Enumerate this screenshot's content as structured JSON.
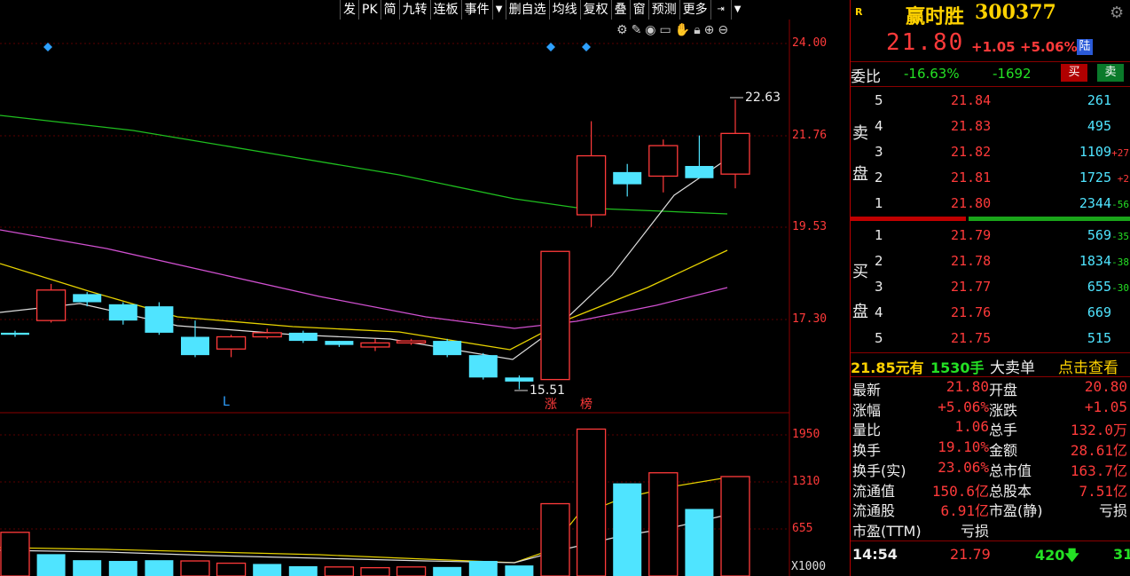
{
  "toolbar": {
    "items": [
      "发",
      "PK",
      "简",
      "九转",
      "连板",
      "事件",
      "删自选",
      "均线",
      "复权",
      "叠",
      "窗",
      "预测",
      "更多"
    ]
  },
  "chart": {
    "price_ticks": [
      "24.00",
      "21.76",
      "19.53",
      "17.30"
    ],
    "volume_ticks": [
      "1950",
      "1310",
      "655",
      "X1000"
    ],
    "high_label": "22.63",
    "low_label": "15.51",
    "tag_zhang": "涨",
    "tag_bang": "榜",
    "tag_l": "L"
  },
  "stock": {
    "badge": "R",
    "name": "赢时胜",
    "code": "300377",
    "price": "21.80",
    "change": "+1.05",
    "pct": "+5.06%",
    "lu": "陆"
  },
  "weibi": {
    "label": "委比",
    "ratio": "-16.63%",
    "diff": "-1692",
    "buy_btn": "买",
    "sell_btn": "卖"
  },
  "sell_side": {
    "label1": "卖",
    "label2": "盘",
    "rows": [
      {
        "lvl": "5",
        "price": "21.84",
        "vol": "261",
        "chg": ""
      },
      {
        "lvl": "4",
        "price": "21.83",
        "vol": "495",
        "chg": ""
      },
      {
        "lvl": "3",
        "price": "21.82",
        "vol": "1109",
        "chg": "+27"
      },
      {
        "lvl": "2",
        "price": "21.81",
        "vol": "1725",
        "chg": "+2"
      },
      {
        "lvl": "1",
        "price": "21.80",
        "vol": "2344",
        "chg": "-56"
      }
    ]
  },
  "buy_side": {
    "label1": "买",
    "label2": "盘",
    "rows": [
      {
        "lvl": "1",
        "price": "21.79",
        "vol": "569",
        "chg": "-35"
      },
      {
        "lvl": "2",
        "price": "21.78",
        "vol": "1834",
        "chg": "-38"
      },
      {
        "lvl": "3",
        "price": "21.77",
        "vol": "655",
        "chg": "-30"
      },
      {
        "lvl": "4",
        "price": "21.76",
        "vol": "669",
        "chg": ""
      },
      {
        "lvl": "5",
        "price": "21.75",
        "vol": "515",
        "chg": ""
      }
    ]
  },
  "big_order": {
    "price": "21.85元有",
    "qty": "1530手",
    "label": "大卖单",
    "link": "点击查看"
  },
  "stats": [
    {
      "k1": "最新",
      "v1": "21.80",
      "k2": "开盘",
      "v2": "20.80"
    },
    {
      "k1": "涨幅",
      "v1": "+5.06%",
      "k2": "涨跌",
      "v2": "+1.05"
    },
    {
      "k1": "量比",
      "v1": "1.06",
      "k2": "总手",
      "v2": "132.0万"
    },
    {
      "k1": "换手",
      "v1": "19.10%",
      "k2": "金额",
      "v2": "28.61亿"
    },
    {
      "k1": "换手(实)",
      "v1": "23.06%",
      "k2": "总市值",
      "v2": "163.7亿"
    },
    {
      "k1": "流通值",
      "v1": "150.6亿",
      "k2": "总股本",
      "v2": "7.51亿"
    },
    {
      "k1": "流通股",
      "v1": "6.91亿",
      "k2": "市盈(静)",
      "v2": "亏损"
    },
    {
      "k1": "市盈(TTM)",
      "v1": "亏损",
      "k2": "",
      "v2": ""
    }
  ],
  "tick": {
    "time": "14:54",
    "price": "21.79",
    "vol": "420",
    "count": "31"
  },
  "chart_data": {
    "type": "candlestick",
    "ylim": [
      15.0,
      24.6
    ],
    "candles": [
      {
        "o": 16.9,
        "c": 16.85,
        "h": 16.95,
        "l": 16.8,
        "up": false
      },
      {
        "o": 17.2,
        "c": 17.95,
        "h": 18.1,
        "l": 17.15,
        "up": true
      },
      {
        "o": 17.85,
        "c": 17.65,
        "h": 17.9,
        "l": 17.55,
        "up": false
      },
      {
        "o": 17.6,
        "c": 17.2,
        "h": 17.65,
        "l": 17.1,
        "up": false
      },
      {
        "o": 17.55,
        "c": 16.9,
        "h": 17.65,
        "l": 16.85,
        "up": false
      },
      {
        "o": 16.8,
        "c": 16.35,
        "h": 17.2,
        "l": 16.3,
        "up": false
      },
      {
        "o": 16.5,
        "c": 16.8,
        "h": 16.85,
        "l": 16.3,
        "up": true
      },
      {
        "o": 16.8,
        "c": 16.9,
        "h": 17.0,
        "l": 16.75,
        "up": true
      },
      {
        "o": 16.9,
        "c": 16.7,
        "h": 16.95,
        "l": 16.65,
        "up": false
      },
      {
        "o": 16.7,
        "c": 16.6,
        "h": 16.7,
        "l": 16.55,
        "up": false
      },
      {
        "o": 16.55,
        "c": 16.65,
        "h": 16.75,
        "l": 16.45,
        "up": true
      },
      {
        "o": 16.65,
        "c": 16.7,
        "h": 16.75,
        "l": 16.6,
        "up": true
      },
      {
        "o": 16.7,
        "c": 16.35,
        "h": 16.75,
        "l": 16.3,
        "up": false
      },
      {
        "o": 16.35,
        "c": 15.8,
        "h": 16.4,
        "l": 15.75,
        "up": false
      },
      {
        "o": 15.8,
        "c": 15.7,
        "h": 15.85,
        "l": 15.51,
        "up": false
      },
      {
        "o": 15.75,
        "c": 18.9,
        "h": 18.9,
        "l": 15.75,
        "up": true
      },
      {
        "o": 19.8,
        "c": 21.25,
        "h": 22.1,
        "l": 19.5,
        "up": true
      },
      {
        "o": 20.85,
        "c": 20.55,
        "h": 21.05,
        "l": 20.25,
        "up": false
      },
      {
        "o": 20.75,
        "c": 21.5,
        "h": 21.65,
        "l": 20.35,
        "up": true
      },
      {
        "o": 21.0,
        "c": 20.7,
        "h": 21.75,
        "l": 20.7,
        "up": false
      },
      {
        "o": 20.8,
        "c": 21.8,
        "h": 22.63,
        "l": 20.45,
        "up": true
      }
    ],
    "volume_ylim": [
      0,
      2050
    ],
    "volumes": [
      {
        "v": 580,
        "up": true
      },
      {
        "v": 290,
        "up": false
      },
      {
        "v": 210,
        "up": false
      },
      {
        "v": 200,
        "up": false
      },
      {
        "v": 210,
        "up": false
      },
      {
        "v": 200,
        "up": true
      },
      {
        "v": 170,
        "up": true
      },
      {
        "v": 160,
        "up": false
      },
      {
        "v": 130,
        "up": false
      },
      {
        "v": 120,
        "up": true
      },
      {
        "v": 110,
        "up": true
      },
      {
        "v": 120,
        "up": true
      },
      {
        "v": 120,
        "up": false
      },
      {
        "v": 200,
        "up": false
      },
      {
        "v": 140,
        "up": false
      },
      {
        "v": 960,
        "up": true
      },
      {
        "v": 1950,
        "up": true
      },
      {
        "v": 1230,
        "up": false
      },
      {
        "v": 1370,
        "up": true
      },
      {
        "v": 890,
        "up": false
      },
      {
        "v": 1320,
        "up": true
      }
    ]
  }
}
